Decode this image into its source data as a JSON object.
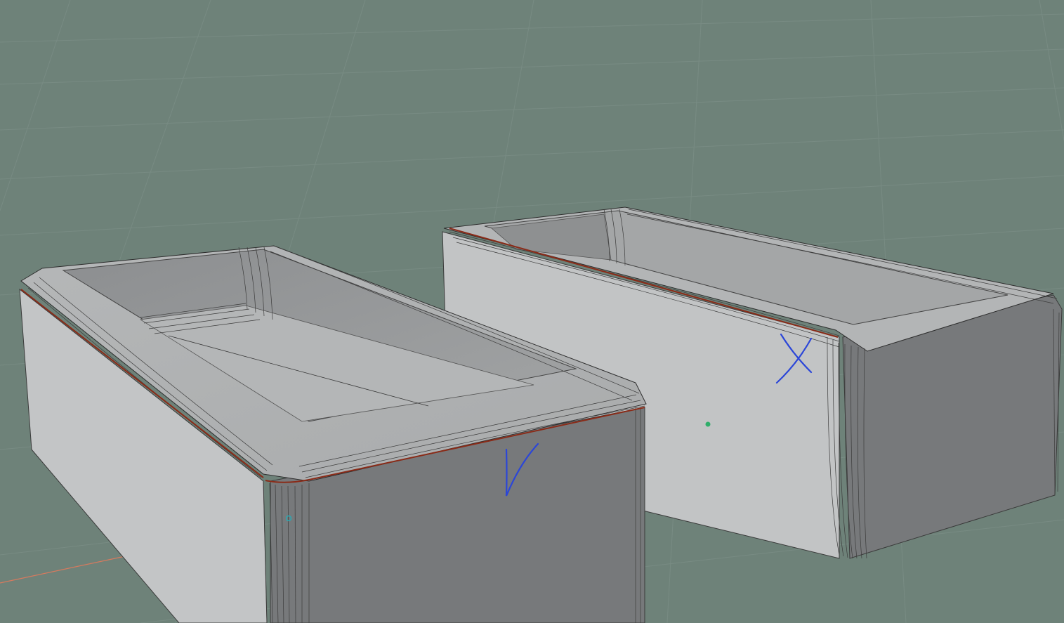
{
  "viewport": {
    "background": "#6e8279",
    "grid_color": "#7a8d85"
  },
  "objects": [
    {
      "name": "left-tray",
      "selected_edge_color": "#8a2b18"
    },
    {
      "name": "right-tray",
      "selected_edge_color": "#8a2b18"
    }
  ],
  "annotations": {
    "check_mark_color": "#2b46d8",
    "cross_mark_color": "#2b46d8"
  },
  "axis": {
    "x_axis_color": "#d77a5e"
  },
  "markers": {
    "cursor_color": "#2fae6a",
    "vertex_dot_color": "#2aa9b3"
  }
}
